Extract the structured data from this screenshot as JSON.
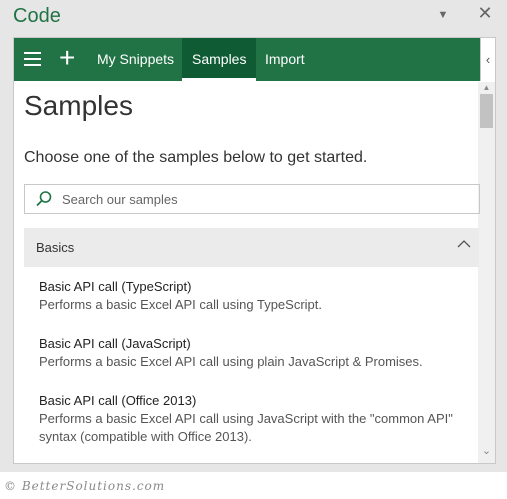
{
  "pane": {
    "title": "Code",
    "menu_icon": "▼",
    "close_icon": "✕"
  },
  "topbar": {
    "menu_icon": "hamburger-icon",
    "add_icon": "+",
    "tabs": [
      {
        "label": "My Snippets",
        "active": false
      },
      {
        "label": "Samples",
        "active": true
      },
      {
        "label": "Import",
        "active": false
      }
    ],
    "collapse_icon": "‹"
  },
  "main": {
    "title": "Samples",
    "subtitle": "Choose one of the samples below to get started.",
    "search": {
      "placeholder": "Search our samples",
      "value": ""
    },
    "section": {
      "label": "Basics",
      "expanded": true
    },
    "items": [
      {
        "title": "Basic API call (TypeScript)",
        "description": "Performs a basic Excel API call using TypeScript."
      },
      {
        "title": "Basic API call (JavaScript)",
        "description": "Performs a basic Excel API call using plain JavaScript & Promises."
      },
      {
        "title": "Basic API call (Office 2013)",
        "description": "Performs a basic Excel API call using JavaScript with the \"common API\" syntax (compatible with Office 2013)."
      }
    ]
  },
  "colors": {
    "accent": "#217346",
    "active_tab": "#0f5c34"
  },
  "watermark": "© BetterSolutions.com"
}
